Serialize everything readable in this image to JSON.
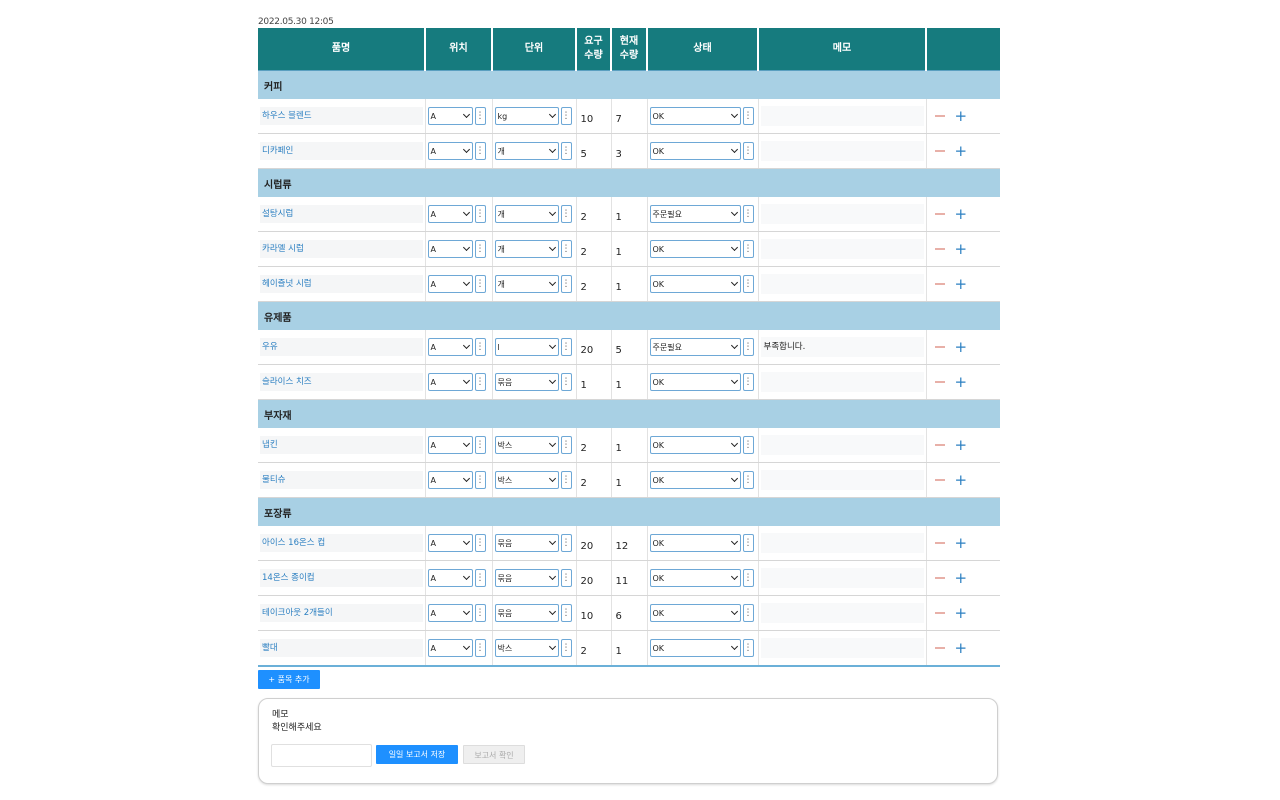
{
  "timestamp": "2022.05.30 12:05",
  "columns": [
    "품명",
    "위치",
    "단위",
    "요구\n수량",
    "현재\n수량",
    "상태",
    "메모",
    ""
  ],
  "colors": {
    "header": "#167b7e",
    "category": "#a8d0e4",
    "link": "#2b7fc1",
    "button": "#1e90ff"
  },
  "categories": [
    {
      "name": "커피",
      "items": [
        {
          "name": "하우스 블렌드",
          "location": "A",
          "unit": "kg",
          "required": "10",
          "current": "7",
          "status": "OK",
          "memo": ""
        },
        {
          "name": "디카페인",
          "location": "A",
          "unit": "개",
          "required": "5",
          "current": "3",
          "status": "OK",
          "memo": ""
        }
      ]
    },
    {
      "name": "시럽류",
      "items": [
        {
          "name": "설탕시럽",
          "location": "A",
          "unit": "개",
          "required": "2",
          "current": "1",
          "status": "주문필요",
          "memo": ""
        },
        {
          "name": "카라멜 시럽",
          "location": "A",
          "unit": "개",
          "required": "2",
          "current": "1",
          "status": "OK",
          "memo": ""
        },
        {
          "name": "헤이즐넛 시럽",
          "location": "A",
          "unit": "개",
          "required": "2",
          "current": "1",
          "status": "OK",
          "memo": ""
        }
      ]
    },
    {
      "name": "유제품",
      "items": [
        {
          "name": "우유",
          "location": "A",
          "unit": "l",
          "required": "20",
          "current": "5",
          "status": "주문필요",
          "memo": "부족합니다."
        },
        {
          "name": "슬라이스 치즈",
          "location": "A",
          "unit": "묶음",
          "required": "1",
          "current": "1",
          "status": "OK",
          "memo": ""
        }
      ]
    },
    {
      "name": "부자재",
      "items": [
        {
          "name": "냅킨",
          "location": "A",
          "unit": "박스",
          "required": "2",
          "current": "1",
          "status": "OK",
          "memo": ""
        },
        {
          "name": "물티슈",
          "location": "A",
          "unit": "박스",
          "required": "2",
          "current": "1",
          "status": "OK",
          "memo": ""
        }
      ]
    },
    {
      "name": "포장류",
      "items": [
        {
          "name": "아이스 16온스 컵",
          "location": "A",
          "unit": "묶음",
          "required": "20",
          "current": "12",
          "status": "OK",
          "memo": ""
        },
        {
          "name": "14온스 종이컵",
          "location": "A",
          "unit": "묶음",
          "required": "20",
          "current": "11",
          "status": "OK",
          "memo": ""
        },
        {
          "name": "테이크아웃 2개들이",
          "location": "A",
          "unit": "묶음",
          "required": "10",
          "current": "6",
          "status": "OK",
          "memo": ""
        },
        {
          "name": "빨대",
          "location": "A",
          "unit": "박스",
          "required": "2",
          "current": "1",
          "status": "OK",
          "memo": ""
        }
      ]
    }
  ],
  "add_item_label": "+ 품목 추가",
  "memo_panel": {
    "label": "메모",
    "text": "확인해주세요",
    "save_label": "일일 보고서 저장",
    "confirm_label": "보고서 확인"
  }
}
